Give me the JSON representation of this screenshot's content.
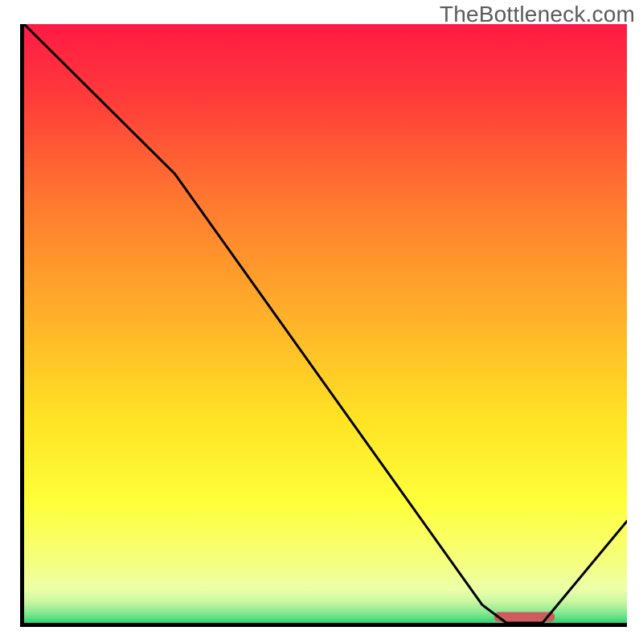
{
  "watermark": "TheBottleneck.com",
  "chart_data": {
    "type": "line",
    "title": "",
    "xlabel": "",
    "ylabel": "",
    "xlim": [
      0,
      100
    ],
    "ylim": [
      0,
      100
    ],
    "grid": false,
    "series": [
      {
        "name": "bottleneck-curve",
        "x": [
          0,
          25,
          76,
          80,
          86,
          100
        ],
        "y": [
          100,
          75,
          3,
          0,
          0,
          17
        ],
        "stroke": "#000000",
        "strokeWidth": 3
      },
      {
        "name": "optimal-marker",
        "type": "bar-segment",
        "x_start": 78,
        "x_end": 88,
        "y": 1,
        "color": "#cd5c5c"
      }
    ],
    "background_gradient": {
      "stops": [
        {
          "offset": 0.0,
          "color": "#ff1a44"
        },
        {
          "offset": 0.12,
          "color": "#ff3a3a"
        },
        {
          "offset": 0.3,
          "color": "#ff7a2f"
        },
        {
          "offset": 0.5,
          "color": "#ffb429"
        },
        {
          "offset": 0.66,
          "color": "#ffe324"
        },
        {
          "offset": 0.8,
          "color": "#ffff3a"
        },
        {
          "offset": 0.9,
          "color": "#f4ff80"
        },
        {
          "offset": 0.945,
          "color": "#ecffaa"
        },
        {
          "offset": 0.965,
          "color": "#c8f7a0"
        },
        {
          "offset": 0.985,
          "color": "#7fe890"
        },
        {
          "offset": 1.0,
          "color": "#2dd36f"
        }
      ]
    }
  }
}
